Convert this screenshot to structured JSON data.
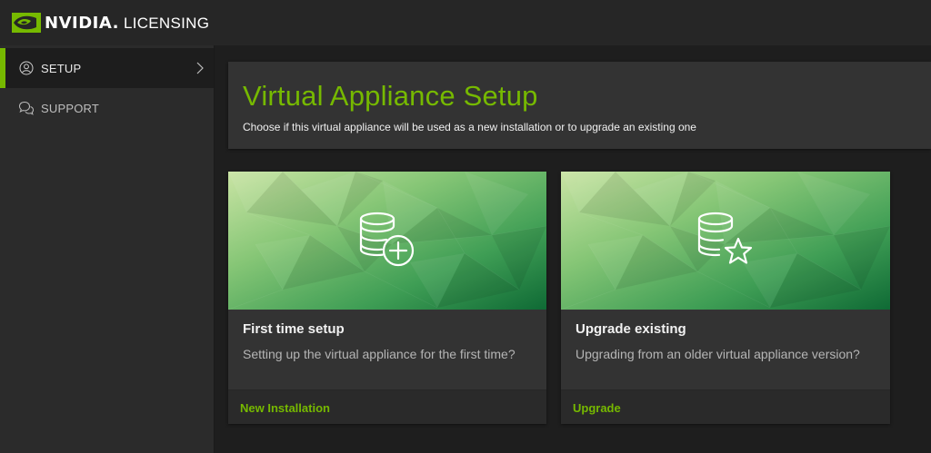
{
  "brand": {
    "name": "NVIDIA.",
    "product": "LICENSING",
    "accent_color": "#76b900"
  },
  "sidebar": {
    "items": [
      {
        "label": "SETUP",
        "icon": "user-circle-icon",
        "active": true
      },
      {
        "label": "SUPPORT",
        "icon": "chat-bubbles-icon",
        "active": false
      }
    ]
  },
  "header": {
    "title": "Virtual Appliance Setup",
    "subtitle": "Choose if this virtual appliance will be used as a new installation or to upgrade an existing one"
  },
  "cards": [
    {
      "icon": "database-plus-icon",
      "title": "First time setup",
      "description": "Setting up the virtual appliance for the first time?",
      "action": "New Installation"
    },
    {
      "icon": "database-star-icon",
      "title": "Upgrade existing",
      "description": "Upgrading from an older virtual appliance version?",
      "action": "Upgrade"
    }
  ]
}
